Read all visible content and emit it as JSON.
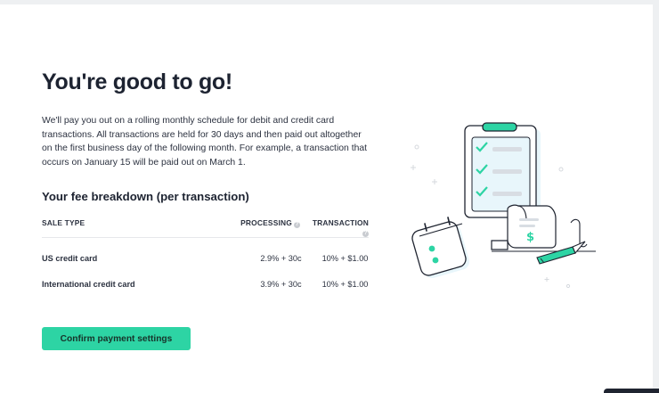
{
  "page": {
    "title": "You're good to go!",
    "description": "We'll pay you out on a rolling monthly schedule for debit and credit card transactions. All transactions are held for 30 days and then paid out altogether on the first business day of the following month. For example, a transaction that occurs on January 15 will be paid out on March 1."
  },
  "fees": {
    "title": "Your fee breakdown (per transaction)",
    "headers": {
      "sale_type": "SALE TYPE",
      "processing": "PROCESSING",
      "transaction": "TRANSACTION"
    },
    "rows": [
      {
        "label": "US credit card",
        "processing": "2.9% + 30c",
        "transaction": "10% + $1.00"
      },
      {
        "label": "International credit card",
        "processing": "3.9% + 30c",
        "transaction": "10% + $1.00"
      }
    ]
  },
  "actions": {
    "confirm_label": "Confirm payment settings"
  },
  "illustration": {
    "icons": [
      "clipboard-checklist-icon",
      "receipt-icon",
      "calendar-icon",
      "pen-icon"
    ],
    "dollar_symbol": "$"
  },
  "colors": {
    "accent": "#2dd4a4",
    "illustration_tint": "#e8f6fb",
    "text": "#1d2331"
  }
}
